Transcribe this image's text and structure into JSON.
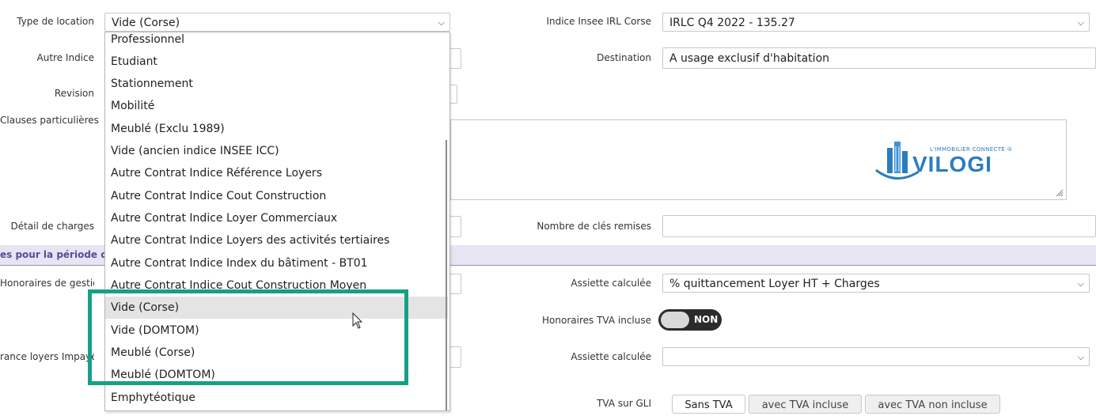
{
  "labels": {
    "type_location": "Type de location",
    "autre_indice": "Autre Indice",
    "revision": "Revision",
    "clauses": "Clauses particulières",
    "detail_charges": "Détail de charges",
    "honoraires_gestion": "Honoraires de gestion",
    "assurance_loyers": "rance loyers Impayé",
    "indice_insee": "Indice Insee IRL Corse",
    "destination": "Destination",
    "nombre_cles": "Nombre de clés remises",
    "assiette_1": "Assiette calculée",
    "honoraires_tva": "Honoraires TVA incluse",
    "assiette_2": "Assiette calculée",
    "tva_gli": "TVA sur GLI"
  },
  "section": {
    "title": "es pour la période du b"
  },
  "fields": {
    "type_location_value": "Vide (Corse)",
    "indice_insee_value": "IRLC Q4 2022 - 135.27",
    "destination_value": "A usage exclusif d'habitation",
    "nombre_cles_value": "",
    "assiette_1_value": "% quittancement Loyer HT + Charges",
    "assiette_2_value": ""
  },
  "dropdown": {
    "options": [
      "Professionnel",
      "Etudiant",
      "Stationnement",
      "Mobilité",
      "Meublé (Exclu 1989)",
      "Vide (ancien indice INSEE ICC)",
      "Autre Contrat Indice Référence Loyers",
      "Autre Contrat Indice Cout Construction",
      "Autre Contrat Indice Loyer Commerciaux",
      "Autre Contrat Indice Loyers des activités tertiaires",
      "Autre Contrat Indice Index du bâtiment - BT01",
      "Autre Contrat Indice Cout Construction Moyen",
      "Vide (Corse)",
      "Vide (DOMTOM)",
      "Meublé (Corse)",
      "Meublé (DOMTOM)",
      "Emphytéotique"
    ],
    "hovered": "Vide (Corse)"
  },
  "toggle": {
    "label": "NON",
    "state": "off"
  },
  "tva_buttons": [
    "Sans TVA",
    "avec TVA incluse",
    "avec TVA non incluse"
  ],
  "logo": {
    "tagline": "L'IMMOBILIER CONNECTÉ ®",
    "name": "VILOGI"
  },
  "colors": {
    "highlight": "#16a085",
    "section_band": "#e8e4f3",
    "section_text": "#5a4a9a",
    "logo": "#2b7dbf"
  },
  "icons": {
    "caret": "chevron-down-icon",
    "cursor": "mouse-pointer-icon"
  }
}
